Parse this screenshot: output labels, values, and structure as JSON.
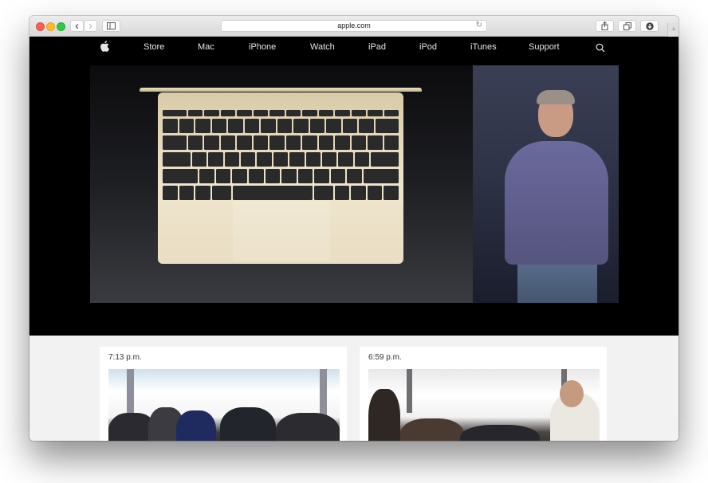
{
  "browser": {
    "url": "apple.com",
    "icons": {
      "back": "chevron-left-icon",
      "forward": "chevron-right-icon",
      "sidebar": "sidebar-icon",
      "reload": "reload-icon",
      "share": "share-icon",
      "tabs": "tab-overview-icon",
      "downloads": "download-icon",
      "new_tab": "plus-icon"
    },
    "glyphs": {
      "back": "‹",
      "forward": "›",
      "reload": "↻",
      "new_tab": "+"
    }
  },
  "nav": {
    "logo": "apple-logo-icon",
    "items": [
      {
        "label": "Store"
      },
      {
        "label": "Mac"
      },
      {
        "label": "iPhone"
      },
      {
        "label": "Watch"
      },
      {
        "label": "iPad"
      },
      {
        "label": "iPod"
      },
      {
        "label": "iTunes"
      },
      {
        "label": "Support"
      }
    ],
    "search_icon": "search-icon"
  },
  "hero": {
    "description": "Keynote video stream: gold MacBook on left screen, presenter on right"
  },
  "live_updates": [
    {
      "time": "7:13 p.m.",
      "image": "crowd photo"
    },
    {
      "time": "6:59 p.m.",
      "image": "hands-on area photo"
    }
  ],
  "colors": {
    "nav_bg": "#000000",
    "nav_text": "#e6e6e6",
    "page_bg": "#f2f2f2",
    "laptop_gold": "#e9dec3",
    "close": "#fc5f57",
    "minimize": "#fdbc2e",
    "zoom": "#33c748"
  }
}
